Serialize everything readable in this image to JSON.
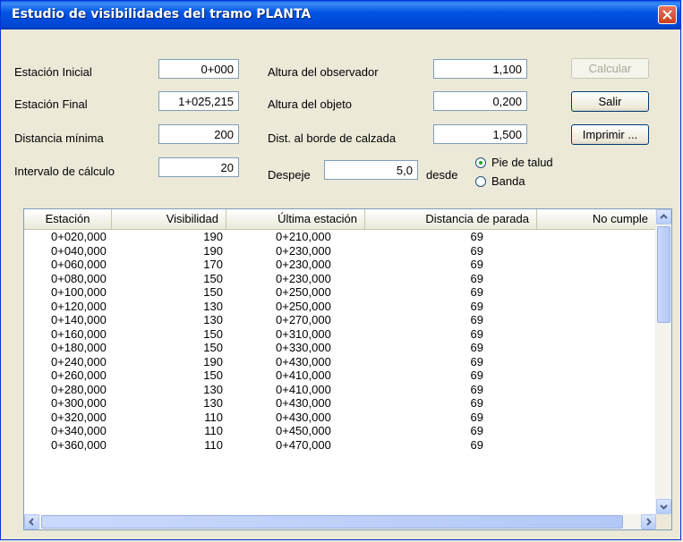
{
  "window": {
    "title": "Estudio de visibilidades del tramo PLANTA"
  },
  "form": {
    "estacion_inicial": {
      "label": "Estación Inicial",
      "value": "0+000"
    },
    "estacion_final": {
      "label": "Estación Final",
      "value": "1+025,215"
    },
    "distancia_minima": {
      "label": "Distancia mínima",
      "value": "200"
    },
    "intervalo": {
      "label": "Intervalo de cálculo",
      "value": "20"
    },
    "altura_observador": {
      "label": "Altura del observador",
      "value": "1,100"
    },
    "altura_objeto": {
      "label": "Altura del objeto",
      "value": "0,200"
    },
    "dist_borde": {
      "label": "Dist. al borde de calzada",
      "value": "1,500"
    },
    "despeje": {
      "label": "Despeje",
      "value": "5,0"
    },
    "desde_label": "desde",
    "radio_pie": "Pie de talud",
    "radio_banda": "Banda",
    "selected_radio": "Pie de talud"
  },
  "buttons": {
    "calcular": "Calcular",
    "salir": "Salir",
    "imprimir": "Imprimir ..."
  },
  "table": {
    "columns": [
      "Estación",
      "Visibilidad",
      "Última estación",
      "Distancia de parada",
      "No cumple"
    ],
    "rows": [
      [
        "0+020,000",
        "190",
        "0+210,000",
        "69",
        ""
      ],
      [
        "0+040,000",
        "190",
        "0+230,000",
        "69",
        ""
      ],
      [
        "0+060,000",
        "170",
        "0+230,000",
        "69",
        ""
      ],
      [
        "0+080,000",
        "150",
        "0+230,000",
        "69",
        ""
      ],
      [
        "0+100,000",
        "150",
        "0+250,000",
        "69",
        ""
      ],
      [
        "0+120,000",
        "130",
        "0+250,000",
        "69",
        ""
      ],
      [
        "0+140,000",
        "130",
        "0+270,000",
        "69",
        ""
      ],
      [
        "0+160,000",
        "150",
        "0+310,000",
        "69",
        ""
      ],
      [
        "0+180,000",
        "150",
        "0+330,000",
        "69",
        ""
      ],
      [
        "0+240,000",
        "190",
        "0+430,000",
        "69",
        ""
      ],
      [
        "0+260,000",
        "150",
        "0+410,000",
        "69",
        ""
      ],
      [
        "0+280,000",
        "130",
        "0+410,000",
        "69",
        ""
      ],
      [
        "0+300,000",
        "130",
        "0+430,000",
        "69",
        ""
      ],
      [
        "0+320,000",
        "110",
        "0+430,000",
        "69",
        ""
      ],
      [
        "0+340,000",
        "110",
        "0+450,000",
        "69",
        ""
      ],
      [
        "0+360,000",
        "110",
        "0+470,000",
        "69",
        ""
      ]
    ]
  }
}
